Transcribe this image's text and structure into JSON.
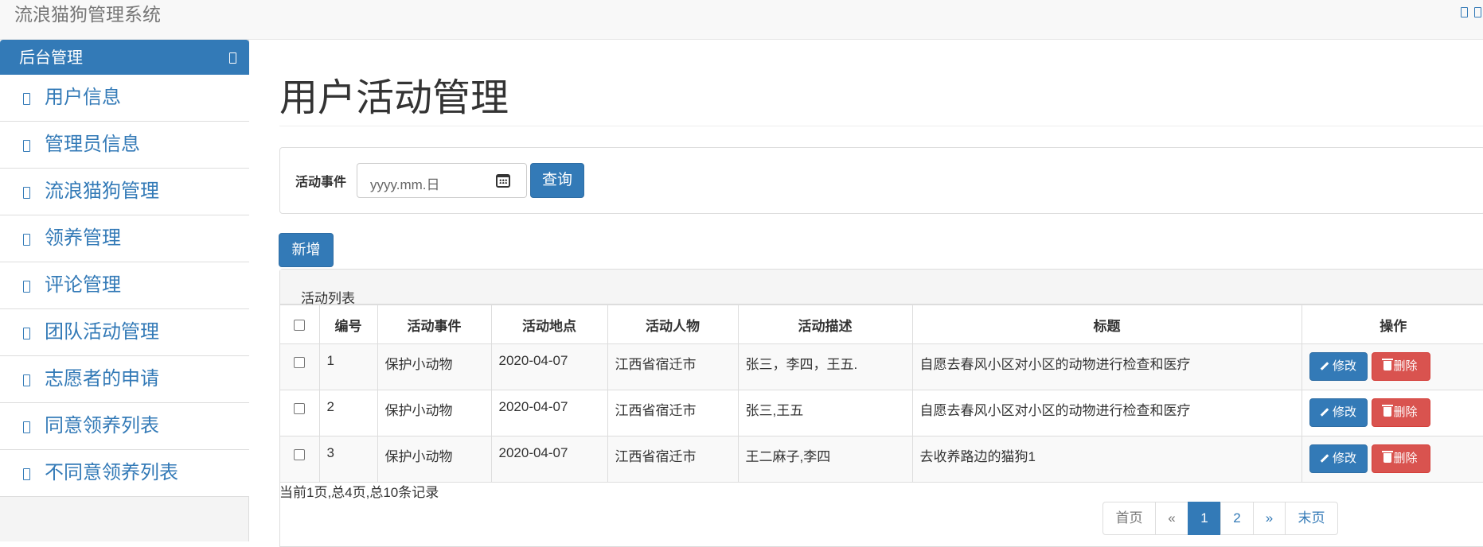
{
  "app": {
    "title": "流浪猫狗管理系统"
  },
  "sidebar": {
    "header": "后台管理",
    "items": [
      {
        "label": "用户信息"
      },
      {
        "label": "管理员信息"
      },
      {
        "label": "流浪猫狗管理"
      },
      {
        "label": "领养管理"
      },
      {
        "label": "评论管理"
      },
      {
        "label": "团队活动管理"
      },
      {
        "label": "志愿者的申请"
      },
      {
        "label": "同意领养列表"
      },
      {
        "label": "不同意领养列表"
      }
    ]
  },
  "main": {
    "page_title": "用户活动管理",
    "query": {
      "label": "活动事件",
      "date_placeholder": "yyyy.mm.日",
      "button": "查询"
    },
    "add_button": "新增",
    "list": {
      "title": "活动列表",
      "columns": [
        "编号",
        "活动事件",
        "活动地点",
        "活动人物",
        "活动描述",
        "标题",
        "操作"
      ],
      "rows": [
        {
          "id": "1",
          "event": "保护小动物",
          "date": "2020-04-07",
          "place": "江西省宿迁市",
          "people": "张三，李四，王五.",
          "title": "自愿去春风小区对小区的动物进行检查和医疗"
        },
        {
          "id": "2",
          "event": "保护小动物",
          "date": "2020-04-07",
          "place": "江西省宿迁市",
          "people": "张三,王五",
          "title": "自愿去春风小区对小区的动物进行检查和医疗"
        },
        {
          "id": "3",
          "event": "保护小动物",
          "date": "2020-04-07",
          "place": "江西省宿迁市",
          "people": "王二麻子,李四",
          "title": "去收养路边的猫狗1"
        }
      ],
      "edit_label": "修改",
      "delete_label": "删除"
    },
    "page_info": "当前1页,总4页,总10条记录",
    "pagination": {
      "first": "首页",
      "prev": "«",
      "pages": [
        "1",
        "2"
      ],
      "next": "»",
      "last": "末页",
      "current": "1"
    }
  },
  "colors": {
    "primary": "#337ab7",
    "danger": "#d9534f",
    "navbar_bg": "#f8f8f8",
    "sidebar_bg": "#f4f4f4"
  },
  "icons": {
    "nav_right": [
      "square-icon",
      "square-icon"
    ],
    "sidebar_header": "collapse-icon",
    "sidebar_item": "menu-icon",
    "date": "calendar-icon",
    "edit": "pencil-icon",
    "delete": "trash-icon"
  }
}
